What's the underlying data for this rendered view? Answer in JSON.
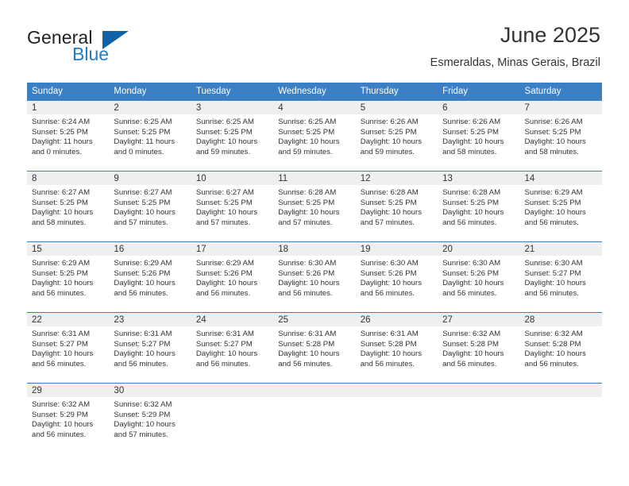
{
  "brand": {
    "word_one": "General",
    "word_two": "Blue",
    "triangle_icon": "brand-triangle-icon",
    "accent_color": "#1f7bc4",
    "triangle_color": "#0f62a8"
  },
  "header": {
    "title": "June 2025",
    "subtitle": "Esmeraldas, Minas Gerais, Brazil"
  },
  "theme": {
    "header_bg": "#3b7fc4",
    "header_text": "#ffffff",
    "daynumber_bg": "#efefef",
    "body_text": "#333333"
  },
  "calendar": {
    "weekdays": [
      "Sunday",
      "Monday",
      "Tuesday",
      "Wednesday",
      "Thursday",
      "Friday",
      "Saturday"
    ],
    "weeks": [
      [
        {
          "day": "1",
          "sunrise": "Sunrise: 6:24 AM",
          "sunset": "Sunset: 5:25 PM",
          "daylight_line1": "Daylight: 11 hours",
          "daylight_line2": "and 0 minutes."
        },
        {
          "day": "2",
          "sunrise": "Sunrise: 6:25 AM",
          "sunset": "Sunset: 5:25 PM",
          "daylight_line1": "Daylight: 11 hours",
          "daylight_line2": "and 0 minutes."
        },
        {
          "day": "3",
          "sunrise": "Sunrise: 6:25 AM",
          "sunset": "Sunset: 5:25 PM",
          "daylight_line1": "Daylight: 10 hours",
          "daylight_line2": "and 59 minutes."
        },
        {
          "day": "4",
          "sunrise": "Sunrise: 6:25 AM",
          "sunset": "Sunset: 5:25 PM",
          "daylight_line1": "Daylight: 10 hours",
          "daylight_line2": "and 59 minutes."
        },
        {
          "day": "5",
          "sunrise": "Sunrise: 6:26 AM",
          "sunset": "Sunset: 5:25 PM",
          "daylight_line1": "Daylight: 10 hours",
          "daylight_line2": "and 59 minutes."
        },
        {
          "day": "6",
          "sunrise": "Sunrise: 6:26 AM",
          "sunset": "Sunset: 5:25 PM",
          "daylight_line1": "Daylight: 10 hours",
          "daylight_line2": "and 58 minutes."
        },
        {
          "day": "7",
          "sunrise": "Sunrise: 6:26 AM",
          "sunset": "Sunset: 5:25 PM",
          "daylight_line1": "Daylight: 10 hours",
          "daylight_line2": "and 58 minutes."
        }
      ],
      [
        {
          "day": "8",
          "sunrise": "Sunrise: 6:27 AM",
          "sunset": "Sunset: 5:25 PM",
          "daylight_line1": "Daylight: 10 hours",
          "daylight_line2": "and 58 minutes."
        },
        {
          "day": "9",
          "sunrise": "Sunrise: 6:27 AM",
          "sunset": "Sunset: 5:25 PM",
          "daylight_line1": "Daylight: 10 hours",
          "daylight_line2": "and 57 minutes."
        },
        {
          "day": "10",
          "sunrise": "Sunrise: 6:27 AM",
          "sunset": "Sunset: 5:25 PM",
          "daylight_line1": "Daylight: 10 hours",
          "daylight_line2": "and 57 minutes."
        },
        {
          "day": "11",
          "sunrise": "Sunrise: 6:28 AM",
          "sunset": "Sunset: 5:25 PM",
          "daylight_line1": "Daylight: 10 hours",
          "daylight_line2": "and 57 minutes."
        },
        {
          "day": "12",
          "sunrise": "Sunrise: 6:28 AM",
          "sunset": "Sunset: 5:25 PM",
          "daylight_line1": "Daylight: 10 hours",
          "daylight_line2": "and 57 minutes."
        },
        {
          "day": "13",
          "sunrise": "Sunrise: 6:28 AM",
          "sunset": "Sunset: 5:25 PM",
          "daylight_line1": "Daylight: 10 hours",
          "daylight_line2": "and 56 minutes."
        },
        {
          "day": "14",
          "sunrise": "Sunrise: 6:29 AM",
          "sunset": "Sunset: 5:25 PM",
          "daylight_line1": "Daylight: 10 hours",
          "daylight_line2": "and 56 minutes."
        }
      ],
      [
        {
          "day": "15",
          "sunrise": "Sunrise: 6:29 AM",
          "sunset": "Sunset: 5:25 PM",
          "daylight_line1": "Daylight: 10 hours",
          "daylight_line2": "and 56 minutes."
        },
        {
          "day": "16",
          "sunrise": "Sunrise: 6:29 AM",
          "sunset": "Sunset: 5:26 PM",
          "daylight_line1": "Daylight: 10 hours",
          "daylight_line2": "and 56 minutes."
        },
        {
          "day": "17",
          "sunrise": "Sunrise: 6:29 AM",
          "sunset": "Sunset: 5:26 PM",
          "daylight_line1": "Daylight: 10 hours",
          "daylight_line2": "and 56 minutes."
        },
        {
          "day": "18",
          "sunrise": "Sunrise: 6:30 AM",
          "sunset": "Sunset: 5:26 PM",
          "daylight_line1": "Daylight: 10 hours",
          "daylight_line2": "and 56 minutes."
        },
        {
          "day": "19",
          "sunrise": "Sunrise: 6:30 AM",
          "sunset": "Sunset: 5:26 PM",
          "daylight_line1": "Daylight: 10 hours",
          "daylight_line2": "and 56 minutes."
        },
        {
          "day": "20",
          "sunrise": "Sunrise: 6:30 AM",
          "sunset": "Sunset: 5:26 PM",
          "daylight_line1": "Daylight: 10 hours",
          "daylight_line2": "and 56 minutes."
        },
        {
          "day": "21",
          "sunrise": "Sunrise: 6:30 AM",
          "sunset": "Sunset: 5:27 PM",
          "daylight_line1": "Daylight: 10 hours",
          "daylight_line2": "and 56 minutes."
        }
      ],
      [
        {
          "day": "22",
          "sunrise": "Sunrise: 6:31 AM",
          "sunset": "Sunset: 5:27 PM",
          "daylight_line1": "Daylight: 10 hours",
          "daylight_line2": "and 56 minutes."
        },
        {
          "day": "23",
          "sunrise": "Sunrise: 6:31 AM",
          "sunset": "Sunset: 5:27 PM",
          "daylight_line1": "Daylight: 10 hours",
          "daylight_line2": "and 56 minutes."
        },
        {
          "day": "24",
          "sunrise": "Sunrise: 6:31 AM",
          "sunset": "Sunset: 5:27 PM",
          "daylight_line1": "Daylight: 10 hours",
          "daylight_line2": "and 56 minutes."
        },
        {
          "day": "25",
          "sunrise": "Sunrise: 6:31 AM",
          "sunset": "Sunset: 5:28 PM",
          "daylight_line1": "Daylight: 10 hours",
          "daylight_line2": "and 56 minutes."
        },
        {
          "day": "26",
          "sunrise": "Sunrise: 6:31 AM",
          "sunset": "Sunset: 5:28 PM",
          "daylight_line1": "Daylight: 10 hours",
          "daylight_line2": "and 56 minutes."
        },
        {
          "day": "27",
          "sunrise": "Sunrise: 6:32 AM",
          "sunset": "Sunset: 5:28 PM",
          "daylight_line1": "Daylight: 10 hours",
          "daylight_line2": "and 56 minutes."
        },
        {
          "day": "28",
          "sunrise": "Sunrise: 6:32 AM",
          "sunset": "Sunset: 5:28 PM",
          "daylight_line1": "Daylight: 10 hours",
          "daylight_line2": "and 56 minutes."
        }
      ],
      [
        {
          "day": "29",
          "sunrise": "Sunrise: 6:32 AM",
          "sunset": "Sunset: 5:29 PM",
          "daylight_line1": "Daylight: 10 hours",
          "daylight_line2": "and 56 minutes."
        },
        {
          "day": "30",
          "sunrise": "Sunrise: 6:32 AM",
          "sunset": "Sunset: 5:29 PM",
          "daylight_line1": "Daylight: 10 hours",
          "daylight_line2": "and 57 minutes."
        },
        {
          "day": "",
          "sunrise": "",
          "sunset": "",
          "daylight_line1": "",
          "daylight_line2": ""
        },
        {
          "day": "",
          "sunrise": "",
          "sunset": "",
          "daylight_line1": "",
          "daylight_line2": ""
        },
        {
          "day": "",
          "sunrise": "",
          "sunset": "",
          "daylight_line1": "",
          "daylight_line2": ""
        },
        {
          "day": "",
          "sunrise": "",
          "sunset": "",
          "daylight_line1": "",
          "daylight_line2": ""
        },
        {
          "day": "",
          "sunrise": "",
          "sunset": "",
          "daylight_line1": "",
          "daylight_line2": ""
        }
      ]
    ]
  }
}
